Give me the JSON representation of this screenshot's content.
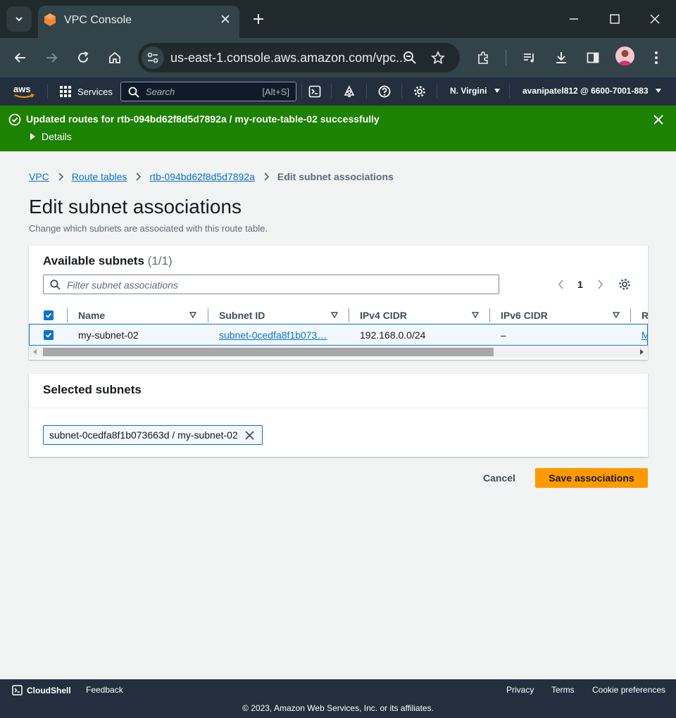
{
  "browser": {
    "tab_title": "VPC Console",
    "url": "us-east-1.console.aws.amazon.com/vpc..."
  },
  "aws_nav": {
    "services_label": "Services",
    "search_placeholder": "Search",
    "search_shortcut": "[Alt+S]",
    "region": "N. Virgini",
    "account": "avanipatel812 @ 6600-7001-883"
  },
  "flash": {
    "message": "Updated routes for rtb-094bd62f8d5d7892a / my-route-table-02 successfully",
    "details_label": "Details",
    "color": "#1d8102"
  },
  "breadcrumb": {
    "items": [
      "VPC",
      "Route tables",
      "rtb-094bd62f8d5d7892a"
    ],
    "current": "Edit subnet associations"
  },
  "page": {
    "title": "Edit subnet associations",
    "description": "Change which subnets are associated with this route table."
  },
  "available_subnets": {
    "title": "Available subnets",
    "count": "(1/1)",
    "filter_placeholder": "Filter subnet associations",
    "current_page": "1",
    "columns": [
      "Name",
      "Subnet ID",
      "IPv4 CIDR",
      "IPv6 CIDR",
      "R"
    ],
    "rows": [
      {
        "checked": true,
        "name": "my-subnet-02",
        "subnet_id": "subnet-0cedfa8f1b073…",
        "ipv4_cidr": "192.168.0.0/24",
        "ipv6_cidr": "–",
        "route_table": "M"
      }
    ]
  },
  "selected_subnets": {
    "title": "Selected subnets",
    "tokens": [
      "subnet-0cedfa8f1b073663d / my-subnet-02"
    ]
  },
  "actions": {
    "cancel_label": "Cancel",
    "save_label": "Save associations",
    "save_color": "#ff9900"
  },
  "footer": {
    "cloudshell_label": "CloudShell",
    "feedback_label": "Feedback",
    "privacy_label": "Privacy",
    "terms_label": "Terms",
    "cookie_label": "Cookie preferences",
    "copyright": "© 2023, Amazon Web Services, Inc. or its affiliates."
  }
}
